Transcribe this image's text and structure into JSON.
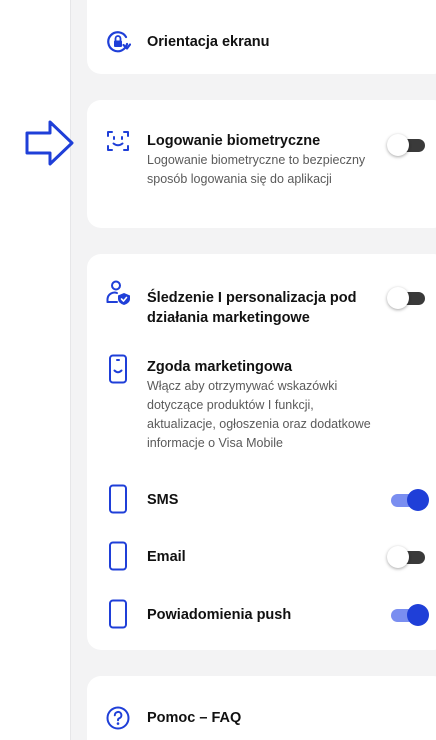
{
  "settings": {
    "screen_orientation": {
      "label": "Orientacja ekranu"
    },
    "biometric": {
      "label": "Logowanie biometryczne",
      "description": "Logowanie biometryczne to bezpieczny sposób logowania się do aplikacji",
      "enabled": false
    },
    "tracking": {
      "label": "Śledzenie I personalizacja pod działania marketingowe",
      "enabled": false
    },
    "marketing_consent": {
      "label": "Zgoda marketingowa",
      "description": "Włącz aby otrzymywać wskazówki dotyczące produktów I funkcji, aktualizacje, ogłoszenia oraz dodatkowe informacje o Visa Mobile"
    },
    "sms": {
      "label": "SMS",
      "enabled": true
    },
    "email": {
      "label": "Email",
      "enabled": false
    },
    "push": {
      "label": "Powiadomienia push",
      "enabled": true
    },
    "help": {
      "label": "Pomoc – FAQ"
    }
  },
  "colors": {
    "accent": "#1f3fd8",
    "toggle_on_track": "#7a8ef0",
    "toggle_off_track": "#3a3a3a",
    "background": "#f3f3f4",
    "card": "#ffffff"
  },
  "icons": {
    "orientation": "screen-rotation-lock-icon",
    "biometric": "face-id-icon",
    "tracking": "user-shield-icon",
    "consent": "phone-smile-icon",
    "sms": "phone-outline-icon",
    "email": "phone-outline-icon",
    "push": "phone-outline-icon",
    "help": "question-circle-icon",
    "pointer": "arrow-right-icon"
  }
}
